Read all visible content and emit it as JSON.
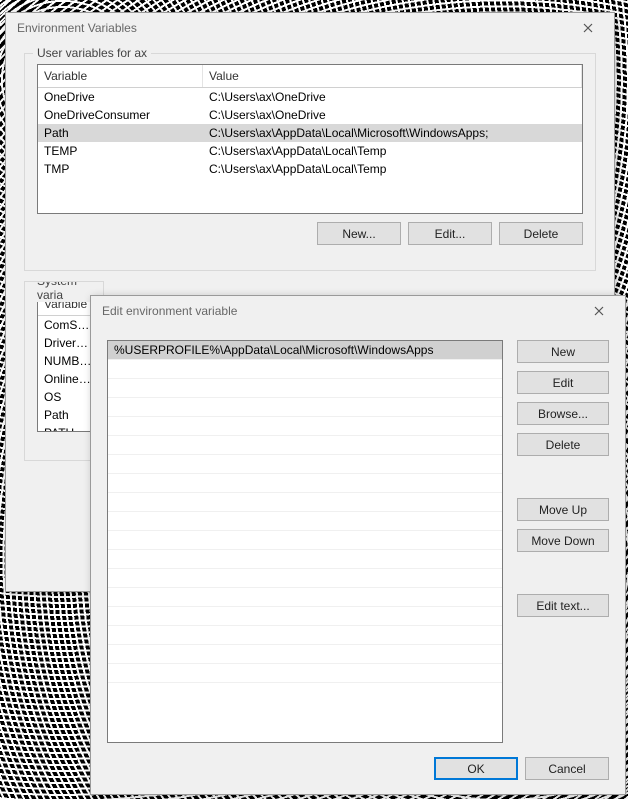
{
  "dlg1": {
    "title": "Environment Variables",
    "group_user_legend": "User variables for ax",
    "headers": {
      "variable": "Variable",
      "value": "Value"
    },
    "user_rows": [
      {
        "variable": "OneDrive",
        "value": "C:\\Users\\ax\\OneDrive",
        "selected": false
      },
      {
        "variable": "OneDriveConsumer",
        "value": "C:\\Users\\ax\\OneDrive",
        "selected": false
      },
      {
        "variable": "Path",
        "value": "C:\\Users\\ax\\AppData\\Local\\Microsoft\\WindowsApps;",
        "selected": true
      },
      {
        "variable": "TEMP",
        "value": "C:\\Users\\ax\\AppData\\Local\\Temp",
        "selected": false
      },
      {
        "variable": "TMP",
        "value": "C:\\Users\\ax\\AppData\\Local\\Temp",
        "selected": false
      }
    ],
    "buttons_user": {
      "new": "New...",
      "edit": "Edit...",
      "delete": "Delete"
    },
    "group_sys_legend": "System varia",
    "sys_rows": [
      {
        "variable": "ComSpec"
      },
      {
        "variable": "DriverData"
      },
      {
        "variable": "NUMBER_"
      },
      {
        "variable": "OnlineSer"
      },
      {
        "variable": "OS"
      },
      {
        "variable": "Path"
      },
      {
        "variable": "PATHEXT"
      }
    ]
  },
  "dlg2": {
    "title": "Edit environment variable",
    "entries": [
      {
        "text": "%USERPROFILE%\\AppData\\Local\\Microsoft\\WindowsApps",
        "selected": true
      }
    ],
    "buttons": {
      "new": "New",
      "edit": "Edit",
      "browse": "Browse...",
      "delete": "Delete",
      "moveup": "Move Up",
      "movedown": "Move Down",
      "edittext": "Edit text..."
    },
    "footer": {
      "ok": "OK",
      "cancel": "Cancel"
    }
  }
}
